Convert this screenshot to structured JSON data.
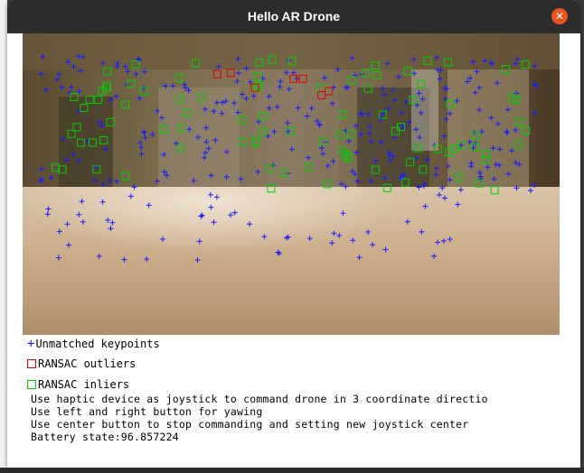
{
  "window": {
    "title": "Hello AR Drone",
    "close_glyph": "✕"
  },
  "legend": {
    "unmatched_label": "Unmatched keypoints",
    "outliers_label": "RANSAC outliers",
    "inliers_label": "RANSAC inliers",
    "unmatched_color": "#1a1aff",
    "outliers_color": "#e00000",
    "inliers_color": "#00d000"
  },
  "instructions": {
    "line1": "Use haptic device as joystick to command drone in 3 coordinate directio",
    "line2": "Use left and right button for yawing",
    "line3": "Use center button to stop commanding and setting new joystick center",
    "battery": "Battery state:96.857224"
  }
}
